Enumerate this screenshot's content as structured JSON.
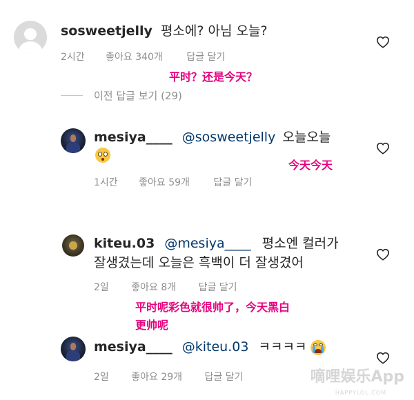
{
  "comments": [
    {
      "username": "sosweetjelly",
      "mention": "",
      "text": "평소에? 아님 오늘?",
      "time": "2시간",
      "likes": "좋아요 340개",
      "reply": "답글 달기",
      "annotation": "平时？还是今天？",
      "avatar": "default-avatar"
    },
    {
      "username": "mesiya____",
      "mention": "@sosweetjelly",
      "text": "오늘오늘",
      "emoji": "flushed-face",
      "time": "1시간",
      "likes": "좋아요 59개",
      "reply": "답글 달기",
      "annotation": "今天今天"
    },
    {
      "username": "kiteu.03",
      "mention": "@mesiya____",
      "text_line1": "평소엔 컬러가",
      "text_line2": "잘생겼는데 오늘은 흑백이 더 잘생겼어",
      "time": "2일",
      "likes": "좋아요 8개",
      "reply": "답글 달기",
      "annotation_line1": "平时呢彩色就很帅了，今天黑白",
      "annotation_line2": "更帅呢"
    },
    {
      "username": "mesiya____",
      "mention": "@kiteu.03",
      "text": "ㅋㅋㅋㅋ",
      "emoji": "crying-face",
      "time": "2일",
      "likes": "좋아요 29개",
      "reply": "답글 달기"
    }
  ],
  "view_previous": "이전 답글 보기 (29)",
  "watermark": "嘀哩娱乐App",
  "watermark_url": "HAPPYLOL.COM",
  "colors": {
    "annotation": "#e6007e",
    "mention": "#00376b",
    "meta": "#8e8e8e"
  }
}
